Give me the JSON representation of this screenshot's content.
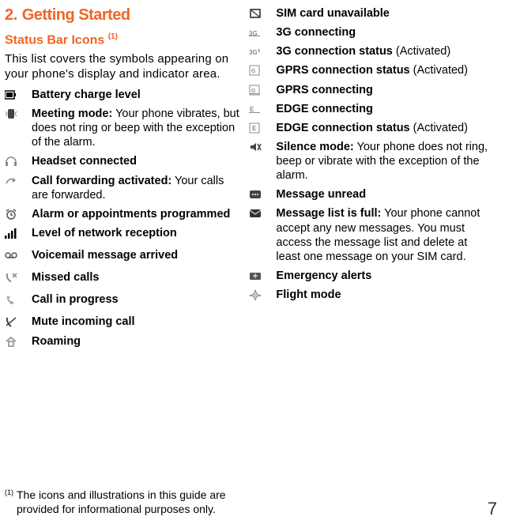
{
  "section": {
    "num": "2.",
    "title": "Getting Started"
  },
  "subsection": {
    "title": "Status Bar Icons",
    "ref": "(1)"
  },
  "intro": "This list covers the symbols appearing on your phone's display and indicator area.",
  "left_items": [
    {
      "bold": "Battery charge level",
      "rest": "",
      "icon": "battery"
    },
    {
      "bold": "Meeting mode:",
      "rest": " Your phone vibrates, but does not ring or beep with the exception of the alarm.",
      "icon": "vibrate"
    },
    {
      "bold": "Headset connected",
      "rest": "",
      "icon": "headset"
    },
    {
      "bold": "Call forwarding activated:",
      "rest": " Your calls are forwarded.",
      "icon": "forward"
    },
    {
      "bold": "Alarm or appointments programmed",
      "rest": "",
      "icon": "alarm"
    },
    {
      "bold": "Level of network reception",
      "rest": "",
      "icon": "signal"
    },
    {
      "bold": "Voicemail message arrived",
      "rest": "",
      "icon": "voicemail"
    },
    {
      "bold": "Missed calls",
      "rest": "",
      "icon": "missed"
    },
    {
      "bold": "Call in progress",
      "rest": "",
      "icon": "call"
    },
    {
      "bold": "Mute incoming call",
      "rest": "",
      "icon": "mute"
    },
    {
      "bold": "Roaming",
      "rest": "",
      "icon": "roaming"
    }
  ],
  "right_items": [
    {
      "bold": "SIM card unavailable",
      "rest": "",
      "icon": "sim"
    },
    {
      "bold": "3G connecting",
      "rest": "",
      "icon": "3gconn"
    },
    {
      "bold": "3G connection status",
      "rest": " (Activated)",
      "icon": "3gact"
    },
    {
      "bold": "GPRS connection status",
      "rest": " (Activated)",
      "icon": "gprsact"
    },
    {
      "bold": "GPRS connecting",
      "rest": "",
      "icon": "gprsconn"
    },
    {
      "bold": "EDGE connecting",
      "rest": "",
      "icon": "edgeconn"
    },
    {
      "bold": "EDGE connection status",
      "rest": " (Activated)",
      "icon": "edgeact"
    },
    {
      "bold": "Silence mode:",
      "rest": " Your phone does not ring, beep or vibrate with the exception of the alarm.",
      "icon": "silence"
    },
    {
      "bold": "Message unread",
      "rest": "",
      "icon": "msg"
    },
    {
      "bold": "Message list is full:",
      "rest": " Your phone cannot accept any new messages. You must access the message list and delete at least one message on your SIM card.",
      "icon": "msgfull"
    },
    {
      "bold": "Emergency alerts",
      "rest": "",
      "icon": "emergency"
    },
    {
      "bold": "Flight mode",
      "rest": "",
      "icon": "flight"
    }
  ],
  "footnote": {
    "ref": "(1)",
    "text": "The icons and illustrations in this guide are provided for informational purposes only."
  },
  "page_number": "7"
}
